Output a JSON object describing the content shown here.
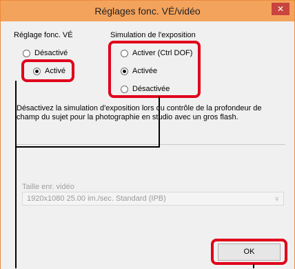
{
  "window": {
    "title": "Réglages fonc. VÉ/vidéo",
    "close_symbol": "✕"
  },
  "ve_function": {
    "label": "Réglage fonc. VÉ",
    "options": [
      {
        "label": "Désactivé",
        "selected": false
      },
      {
        "label": "Activé",
        "selected": true
      }
    ]
  },
  "exposure_simulation": {
    "label": "Simulation de l'exposition",
    "options": [
      {
        "label": "Activer (Ctrl DOF)",
        "selected": false
      },
      {
        "label": "Activée",
        "selected": true
      },
      {
        "label": "Désactivée",
        "selected": false
      }
    ]
  },
  "description": "Désactivez la simulation d'exposition lors du contrôle de la profondeur de champ du sujet pour la photographie en studio avec un gros flash.",
  "video": {
    "label": "Taille enr. vidéo",
    "selected_value": "1920x1080 25.00 im./sec. Standard (IPB)",
    "enabled": false
  },
  "buttons": {
    "ok_label": "OK"
  },
  "colors": {
    "titlebar": "#f4a35d",
    "highlight": "#e0001b",
    "close_button": "#c9443f"
  }
}
